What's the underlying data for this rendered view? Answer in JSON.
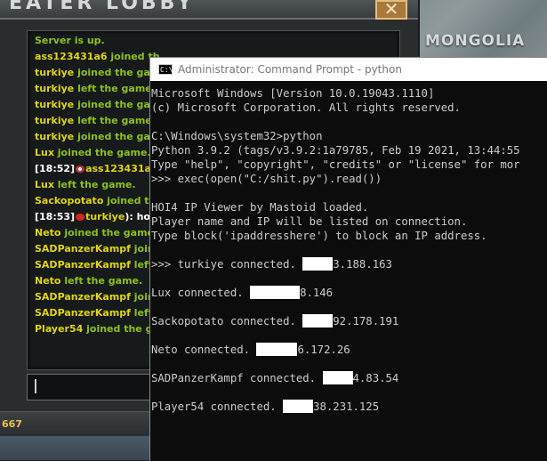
{
  "lobby": {
    "title": "EATER LOBBY",
    "close_icon": "✕",
    "chat": [
      {
        "text": "Server is up.",
        "color": "green"
      },
      {
        "name": "ass123431a6",
        "rest": " joined th",
        "color": "yellow"
      },
      {
        "name": "turkiye",
        "rest": " joined the gam",
        "color": "yellow"
      },
      {
        "name": "turkiye",
        "rest": " left the game.",
        "color": "yellow"
      },
      {
        "name": "turkiye",
        "rest": " joined the gam",
        "color": "yellow"
      },
      {
        "name": "turkiye",
        "rest": " left the game.",
        "color": "yellow"
      },
      {
        "name": "turkiye",
        "rest": " joined the gam",
        "color": "yellow"
      },
      {
        "name": "Lux",
        "rest": " joined the game.",
        "color": "yellow"
      },
      {
        "time": "[18:52]",
        "name": "ass123431a6",
        "color": "white"
      },
      {
        "name": "Lux",
        "rest": " left the game.",
        "color": "yellow"
      },
      {
        "name": "Sackopotato",
        "rest": " joined th",
        "color": "yellow"
      },
      {
        "time": "[18:53]",
        "name": "turkiye",
        "rest": "): how",
        "color": "white"
      },
      {
        "name": "Neto",
        "rest": " joined the game",
        "color": "yellow"
      },
      {
        "name": "SADPanzerKampf",
        "rest": " join",
        "color": "yellow"
      },
      {
        "name": "SADPanzerKampf",
        "rest": " left",
        "color": "yellow"
      },
      {
        "name": "Neto",
        "rest": " left the game.",
        "color": "yellow"
      },
      {
        "name": "SADPanzerKampf",
        "rest": " join",
        "color": "yellow"
      },
      {
        "name": "SADPanzerKampf",
        "rest": " left",
        "color": "yellow"
      },
      {
        "name": "Player54",
        "rest": " joined the ga",
        "color": "yellow"
      }
    ],
    "bottom_value": "667"
  },
  "map": {
    "label": "MONGOLIA"
  },
  "console": {
    "title": "Administrator: Command Prompt - python",
    "icon_glyph": "C:\\",
    "lines": {
      "l1": "Microsoft Windows [Version 10.0.19043.1110]",
      "l2": "(c) Microsoft Corporation. All rights reserved.",
      "l3": "C:\\Windows\\system32>python",
      "l4": "Python 3.9.2 (tags/v3.9.2:1a79785, Feb 19 2021, 13:44:55",
      "l5": "Type \"help\", \"copyright\", \"credits\" or \"license\" for mor",
      "l6": ">>> exec(open(\"C:/shit.py\").read())",
      "l7": "HOI4 IP Viewer by Mastoid loaded.",
      "l8": "Player name and IP will be listed on connection.",
      "l9": "Type block('ipaddresshere') to block an IP address."
    },
    "connections": [
      {
        "prefix": ">>> turkiye connected. ",
        "ip_tail": "3.188.163"
      },
      {
        "prefix": "Lux connected. ",
        "ip_tail": "8.146"
      },
      {
        "prefix": "Sackopotato connected. ",
        "ip_tail": "92.178.191"
      },
      {
        "prefix": "Neto connected. ",
        "ip_tail": "6.172.26"
      },
      {
        "prefix": "SADPanzerKampf connected. ",
        "ip_tail": "4.83.54"
      },
      {
        "prefix": "Player54 connected. ",
        "ip_tail": "38.231.125"
      }
    ]
  },
  "colors": {
    "chat_green": "#89c21c",
    "chat_yellow": "#e0d410",
    "console_text": "#cccccc",
    "redaction": "#ffffff"
  }
}
